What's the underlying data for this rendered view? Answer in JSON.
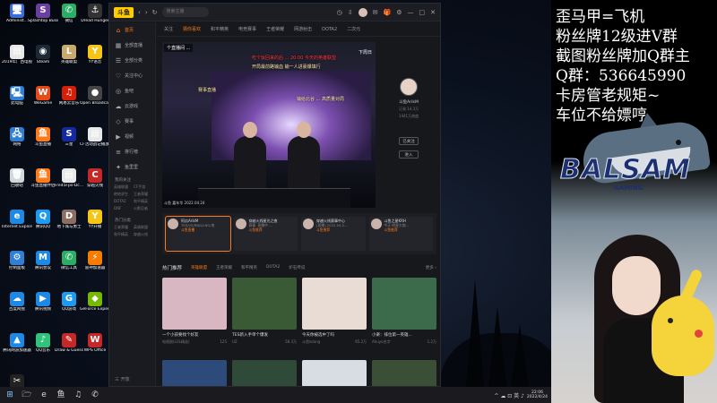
{
  "desktop": {
    "icons": [
      {
        "label": "Administ...",
        "color": "#3a6fd8",
        "glyph": "🖥"
      },
      {
        "label": "Splashtop Business",
        "color": "#6b3fa0",
        "glyph": "S"
      },
      {
        "label": "微信",
        "color": "#2aae67",
        "glyph": "✆"
      },
      {
        "label": "Dread Hunger",
        "color": "#333333",
        "glyph": "⚓"
      },
      {
        "label": "2019年广西电视编导...",
        "color": "#e8e8e8",
        "glyph": "▤"
      },
      {
        "label": "Steam",
        "color": "#1b2838",
        "glyph": "◉"
      },
      {
        "label": "英雄联盟",
        "color": "#c8aa6e",
        "glyph": "L"
      },
      {
        "label": "YY语音",
        "color": "#f5c518",
        "glyph": "Y"
      },
      {
        "label": "此电脑",
        "color": "#2f7fd6",
        "glyph": "🖳"
      },
      {
        "label": "WeGame",
        "color": "#e64a19",
        "glyph": "W"
      },
      {
        "label": "网易云音乐",
        "color": "#d81e06",
        "glyph": "♫"
      },
      {
        "label": "Open Broadcast...",
        "color": "#444444",
        "glyph": "●"
      },
      {
        "label": "网络",
        "color": "#2f7fd6",
        "glyph": "🖧"
      },
      {
        "label": "斗鱼直播",
        "color": "#ff7a1a",
        "glyph": "鱼"
      },
      {
        "label": "三星",
        "color": "#1428a0",
        "glyph": "S"
      },
      {
        "label": "CF活动战记播放文档",
        "color": "#e8e8e8",
        "glyph": "▤"
      },
      {
        "label": "回收站",
        "color": "#cfd8dc",
        "glyph": "🗑"
      },
      {
        "label": "斗鱼直播伴侣",
        "color": "#ff7a1a",
        "glyph": "鱼"
      },
      {
        "label": "Fre45Fps-Dc...",
        "color": "#e8e8e8",
        "glyph": "▤"
      },
      {
        "label": "穿越火线",
        "color": "#c62828",
        "glyph": "C"
      },
      {
        "label": "Internet Explorer",
        "color": "#1e88e5",
        "glyph": "e"
      },
      {
        "label": "腾讯QQ",
        "color": "#1e9bf0",
        "glyph": "Q"
      },
      {
        "label": "地下城与勇士",
        "color": "#8d6e63",
        "glyph": "D"
      },
      {
        "label": "YY开播",
        "color": "#f5c518",
        "glyph": "Y"
      },
      {
        "label": "控制面板",
        "color": "#2f7fd6",
        "glyph": "⚙"
      },
      {
        "label": "腾讯会议",
        "color": "#1e88e5",
        "glyph": "M"
      },
      {
        "label": "微信工具",
        "color": "#2aae67",
        "glyph": "✆"
      },
      {
        "label": "雷神加速器",
        "color": "#f57c00",
        "glyph": "⚡"
      },
      {
        "label": "百度网盘",
        "color": "#1e88e5",
        "glyph": "☁"
      },
      {
        "label": "腾讯视频",
        "color": "#1e88e5",
        "glyph": "▶"
      },
      {
        "label": "QQ游戏",
        "color": "#1e9bf0",
        "glyph": "G"
      },
      {
        "label": "GeForce Experience",
        "color": "#76b900",
        "glyph": "◆"
      },
      {
        "label": "腾讯网游加速器",
        "color": "#1e88e5",
        "glyph": "▲"
      },
      {
        "label": "QQ音乐",
        "color": "#31c27c",
        "glyph": "♪"
      },
      {
        "label": "Draw & Guess",
        "color": "#c62828",
        "glyph": "✎"
      },
      {
        "label": "WPS Office",
        "color": "#c62828",
        "glyph": "W"
      },
      {
        "label": "剪映专业版",
        "color": "#222222",
        "glyph": "✂"
      }
    ]
  },
  "taskbar": {
    "start_glyph": "⊞",
    "pinned": [
      "🗁",
      "e",
      "鱼",
      "♫",
      "✆"
    ],
    "tray_text": "^ ☁ ⊡ 英 ♪",
    "time": "22:06",
    "date": "2022/4/24"
  },
  "app": {
    "logo": "斗鱼",
    "nav_back": "‹",
    "nav_forward": "›",
    "refresh": "↻",
    "search_placeholder": "搜索主播",
    "sidebar": [
      {
        "label": "首页",
        "icon": "⌂",
        "active": true
      },
      {
        "label": "全部直播",
        "icon": "▦",
        "active": false
      },
      {
        "label": "全部分类",
        "icon": "☰",
        "active": false
      },
      {
        "label": "关注中心",
        "icon": "♡",
        "active": false
      },
      {
        "label": "鱼吧",
        "icon": "◎",
        "active": false
      },
      {
        "label": "云游戏",
        "icon": "☁",
        "active": false
      },
      {
        "label": "赛事",
        "icon": "◇",
        "active": false
      },
      {
        "label": "视频",
        "icon": "▶",
        "active": false
      },
      {
        "label": "排行榜",
        "icon": "≡",
        "active": false
      },
      {
        "label": "鱼里里",
        "icon": "✦",
        "active": false
      }
    ],
    "section1_title": "我的关注",
    "section1_items": [
      "英雄联盟",
      "CF手游",
      "绝地求生",
      "王者荣耀",
      "DOTA2",
      "和平精英",
      "DNF",
      "火影忍者"
    ],
    "section2_title": "热门分类",
    "section2_items": [
      "王者荣耀",
      "英雄联盟",
      "和平精英",
      "穿越火线"
    ],
    "bottom_label": "三 开放",
    "tabs": [
      {
        "label": "关注",
        "active": false
      },
      {
        "label": "猜你喜欢",
        "active": true
      },
      {
        "label": "和平精英",
        "active": false
      },
      {
        "label": "电竞赛事",
        "active": false
      },
      {
        "label": "王者荣耀",
        "active": false
      },
      {
        "label": "网游射击",
        "active": false
      },
      {
        "label": "DOTA2",
        "active": false
      },
      {
        "label": "二次元",
        "active": false
      }
    ],
    "player": {
      "ticker": "个直播间 ...",
      "ticker_right": "下周日",
      "banner_lines": [
        "吃个饭回来的后 ... 20:00 今天的英雄联盟",
        "开局最前路输血  输一人进豪爆填行",
        "输给北谷 ...  高质量对局"
      ],
      "overlay_left": "赛事直播",
      "footer": "斗鱼 嘉年华 2022.04.24"
    },
    "streamer": {
      "name": "斗鱼ArikM",
      "sub1": "订阅 14.3万",
      "sub2": "1441万热度",
      "follow_label": "已关注",
      "more_label": "进入"
    },
    "recs": [
      {
        "title": "阿瓜ArikM",
        "sub": "TES/V5/RNG/LNG/电",
        "tag": "斗鱼直播",
        "active": true
      },
      {
        "title": "穿越火线星光之夜",
        "sub": "赛事 ·直播中 ...",
        "tag": "斗鱼推荐",
        "active": false
      },
      {
        "title": "穿越火线赛事中心",
        "sub": "[直播] 2022.04.2...",
        "tag": "斗鱼推荐",
        "active": false
      },
      {
        "title": "斗鱼之星KRH",
        "sub": "今天·明星大咖...",
        "tag": "斗鱼推荐",
        "active": false
      }
    ],
    "hot": {
      "title": "热门推荐",
      "tabs": [
        {
          "label": "英雄联盟",
          "active": true
        },
        {
          "label": "王者荣耀",
          "active": false
        },
        {
          "label": "和平精英",
          "active": false
        },
        {
          "label": "DOTA2",
          "active": false
        },
        {
          "label": "炉石传说",
          "active": false
        }
      ],
      "more": "更多 ›"
    },
    "cards": [
      {
        "title": "一个小孩要找个好友",
        "meta_left": "电视剧(LOL精选)",
        "meta_right": "125",
        "color": "#d9b7c2"
      },
      {
        "title": "TES新入手单个爆发",
        "meta_left": "UZ",
        "meta_right": "58.3万",
        "color": "#3a5a35"
      },
      {
        "title": "今天你被选中了吗",
        "meta_left": "斗鱼lolang",
        "meta_right": "95.2万",
        "color": "#e9dcd4"
      },
      {
        "title": "小楽：排位第一英雄...",
        "meta_left": "Ahuyo名字",
        "meta_right": "1.2万",
        "color": "#3b6b4a"
      },
      {
        "title": "",
        "meta_left": "",
        "meta_right": "",
        "color": "#2c4a7a"
      },
      {
        "title": "",
        "meta_left": "",
        "meta_right": "",
        "color": "#304a3a"
      },
      {
        "title": "",
        "meta_left": "",
        "meta_right": "",
        "color": "#d8dde3"
      },
      {
        "title": "",
        "meta_left": "",
        "meta_right": "",
        "color": "#3a4f35"
      }
    ]
  },
  "overlay": {
    "lines": [
      "歪马甲=飞机",
      "粉丝牌12级进V群",
      "截图粉丝牌加Q群主",
      "Q群：536645990",
      "卡房管老规矩~",
      "车位不给嫖哼"
    ],
    "brand": "BALSAM",
    "brand_sub": "GAMING",
    "colors": {
      "brand": "#1c2f6e",
      "shark": "#5b6f82",
      "accent": "#ff7a1a"
    }
  }
}
